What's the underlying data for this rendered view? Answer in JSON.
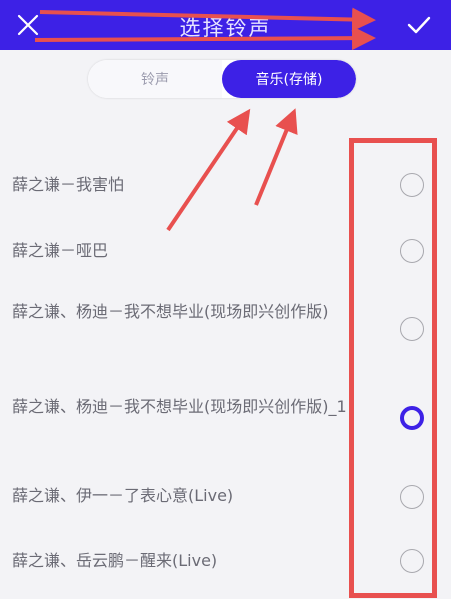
{
  "header": {
    "title": "选择铃声",
    "close_icon": "close-icon",
    "confirm_icon": "check-icon",
    "background_color": "#3d21e6"
  },
  "tabs": [
    {
      "label": "铃声",
      "selected": false
    },
    {
      "label": "音乐(存储)",
      "selected": true
    }
  ],
  "songs": [
    {
      "name": "薛之谦－我害怕",
      "selected": false
    },
    {
      "name": "薛之谦－哑巴",
      "selected": false
    },
    {
      "name": "薛之谦、杨迪－我不想毕业(现场即兴创作版)",
      "selected": false
    },
    {
      "name": "薛之谦、杨迪－我不想毕业(现场即兴创作版)_1",
      "selected": true
    },
    {
      "name": "薛之谦、伊一－了表心意(Live)",
      "selected": false
    },
    {
      "name": "薛之谦、岳云鹏－醒来(Live)",
      "selected": false
    }
  ],
  "colors": {
    "accent": "#3d21e6",
    "annotation": "#e8504f",
    "text": "#6b6b75"
  }
}
